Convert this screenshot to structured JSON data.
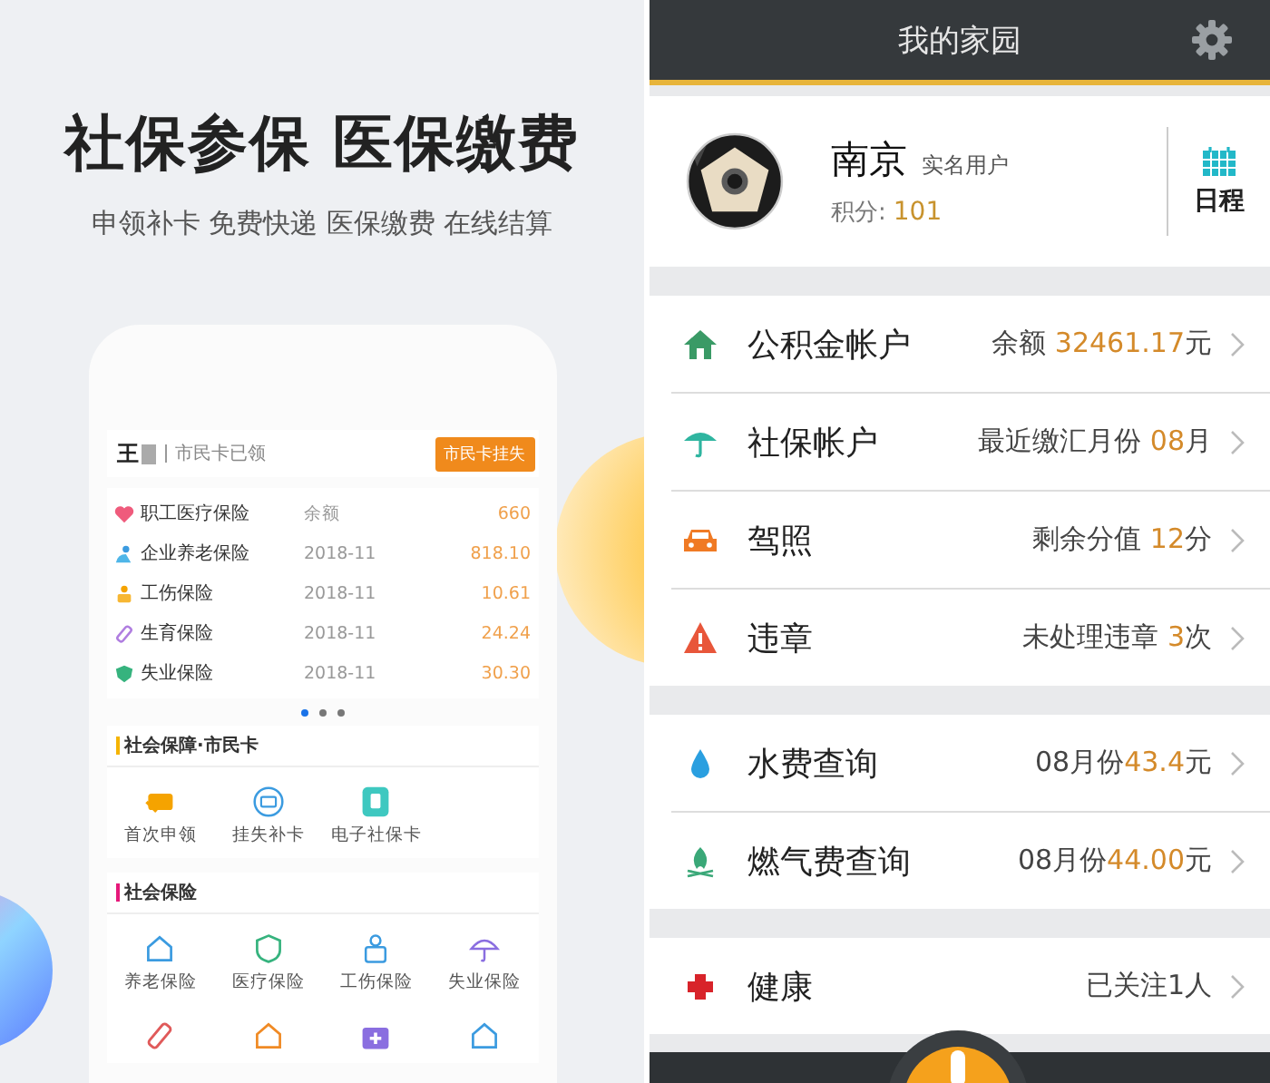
{
  "promo": {
    "headline": "社保参保 医保缴费",
    "subline": "申领补卡 免费快递 医保缴费 在线结算"
  },
  "phone": {
    "card_holder": "王",
    "card_status": "市民卡已领",
    "report_button": "市民卡挂失",
    "insurance": [
      {
        "name": "职工医疗保险",
        "column_2": "余额",
        "amount": "660"
      },
      {
        "name": "企业养老保险",
        "column_2": "2018-11",
        "amount": "818.10"
      },
      {
        "name": "工伤保险",
        "column_2": "2018-11",
        "amount": "10.61"
      },
      {
        "name": "生育保险",
        "column_2": "2018-11",
        "amount": "24.24"
      },
      {
        "name": "失业保险",
        "column_2": "2018-11",
        "amount": "30.30"
      }
    ],
    "pager": [
      {
        "selected": true
      },
      {
        "selected": false
      },
      {
        "selected": false
      }
    ],
    "sections": [
      {
        "title": "社会保障·市民卡",
        "color": "#f5b400",
        "items": [
          {
            "kind": "labeled",
            "label": "首次申领"
          },
          {
            "kind": "labeled",
            "label": "挂失补卡"
          },
          {
            "kind": "labeled",
            "label": "电子社保卡"
          }
        ]
      },
      {
        "title": "社会保险",
        "color": "#e6197a",
        "items": [
          {
            "kind": "labeled",
            "label": "养老保险"
          },
          {
            "kind": "labeled",
            "label": "医疗保险"
          },
          {
            "kind": "labeled",
            "label": "工伤保险"
          },
          {
            "kind": "labeled",
            "label": "失业保险"
          },
          {
            "kind": "icon"
          },
          {
            "kind": "icon"
          },
          {
            "kind": "icon"
          },
          {
            "kind": "icon"
          }
        ]
      }
    ]
  },
  "app": {
    "title": "我的家园",
    "profile": {
      "name": "南京",
      "badge": "实名用户",
      "points_label": "积分:",
      "points": "101",
      "schedule": "日程"
    },
    "groups": [
      [
        {
          "label": "公积金帐户",
          "prefix": "余额 ",
          "amount": "32461.17",
          "unit": "元"
        },
        {
          "label": "社保帐户",
          "prefix": "最近缴汇月份 ",
          "amount": "08",
          "unit": "月"
        },
        {
          "label": "驾照",
          "prefix": "剩余分值 ",
          "amount": "12",
          "unit": "分"
        },
        {
          "label": "违章",
          "prefix": "未处理违章 ",
          "amount": "3",
          "unit": "次"
        }
      ],
      [
        {
          "label": "水费查询",
          "prefix": "08月份",
          "amount": "43.4",
          "unit": "元"
        },
        {
          "label": "燃气费查询",
          "prefix": "08月份",
          "amount": "44.00",
          "unit": "元"
        }
      ],
      [
        {
          "label": "健康",
          "prefix": "已关注1人"
        }
      ]
    ]
  }
}
